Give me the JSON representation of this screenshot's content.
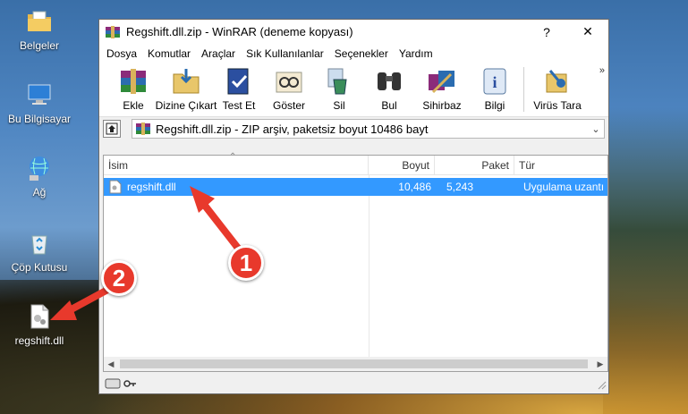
{
  "desktop": {
    "icons": [
      {
        "label": "Belgeler",
        "icon": "folder-documents-icon"
      },
      {
        "label": "Bu Bilgisayar",
        "icon": "computer-icon"
      },
      {
        "label": "Ağ",
        "icon": "network-icon"
      },
      {
        "label": "Çöp Kutusu",
        "icon": "recycle-bin-icon"
      },
      {
        "label": "regshift.dll",
        "icon": "dll-file-icon"
      }
    ]
  },
  "window": {
    "title": "Regshift.dll.zip - WinRAR (deneme kopyası)",
    "help_button": "?",
    "close_button": "✕",
    "menu": [
      "Dosya",
      "Komutlar",
      "Araçlar",
      "Sık Kullanılanlar",
      "Seçenekler",
      "Yardım"
    ],
    "toolbar": [
      {
        "label": "Ekle",
        "icon": "add-archive-icon"
      },
      {
        "label": "Dizine Çıkart",
        "icon": "extract-to-icon"
      },
      {
        "label": "Test Et",
        "icon": "test-icon"
      },
      {
        "label": "Göster",
        "icon": "view-icon"
      },
      {
        "label": "Sil",
        "icon": "delete-icon"
      },
      {
        "label": "Bul",
        "icon": "find-icon"
      },
      {
        "label": "Sihirbaz",
        "icon": "wizard-icon"
      },
      {
        "label": "Bilgi",
        "icon": "info-icon"
      },
      {
        "label": "Virüs Tara",
        "icon": "virus-scan-icon"
      }
    ],
    "toolbar_more": "»",
    "address": "Regshift.dll.zip - ZIP arşiv, paketsiz boyut 10486 bayt",
    "columns": {
      "name": "İsim",
      "size": "Boyut",
      "packed": "Paket",
      "type": "Tür"
    },
    "files": [
      {
        "name": "regshift.dll",
        "size": "10,486",
        "packed": "5,243",
        "type": "Uygulama uzantı"
      }
    ]
  },
  "annotations": {
    "step1": "1",
    "step2": "2"
  },
  "colors": {
    "selection": "#3399ff",
    "badge": "#e8392c",
    "arrow": "#e8392c"
  }
}
